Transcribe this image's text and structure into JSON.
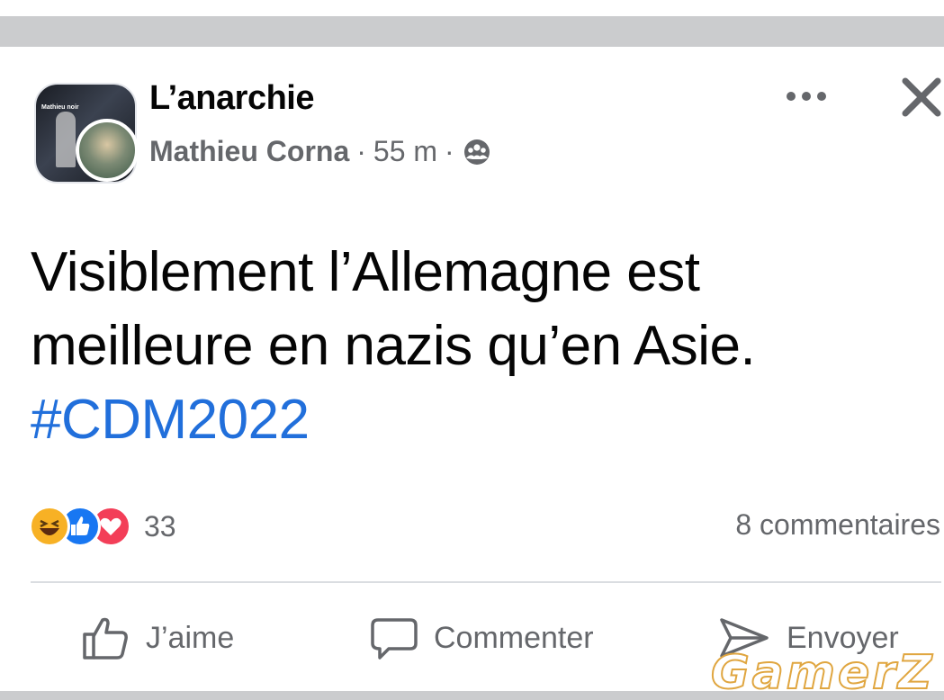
{
  "post": {
    "group_name": "L’anarchie",
    "group_avatar_label": "Mathieu noir",
    "author": "Mathieu Corna",
    "time": "55 m",
    "separator": "·",
    "privacy_icon": "group-icon",
    "text_lines": [
      "Visiblement l’Allemagne est",
      "meilleure en nazis qu’en Asie."
    ],
    "hashtag": "#CDM2022"
  },
  "engagement": {
    "reaction_icons": [
      "haha-icon",
      "like-icon",
      "love-icon"
    ],
    "reaction_count": "33",
    "comments": "8 commentaires"
  },
  "actions": {
    "like_label": "J’aime",
    "comment_label": "Commenter",
    "share_label": "Envoyer"
  },
  "watermark": "GamerZ",
  "colors": {
    "hashtag": "#216fdb",
    "secondary_text": "#65676b",
    "like_blue": "#1877f2",
    "haha_yellow": "#f7b125",
    "love_red": "#f33e58"
  }
}
